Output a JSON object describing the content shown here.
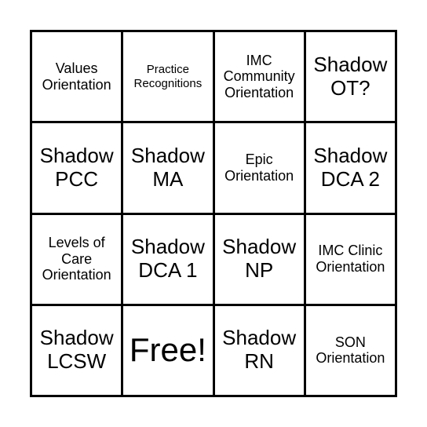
{
  "board": {
    "cells": [
      {
        "text": "Values\nOrientation",
        "size": "md"
      },
      {
        "text": "Practice\nRecognitions",
        "size": "sm"
      },
      {
        "text": "IMC\nCommunity\nOrientation",
        "size": "md"
      },
      {
        "text": "Shadow\nOT?",
        "size": "lg"
      },
      {
        "text": "Shadow\nPCC",
        "size": "lg"
      },
      {
        "text": "Shadow\nMA",
        "size": "lg"
      },
      {
        "text": "Epic\nOrientation",
        "size": "md"
      },
      {
        "text": "Shadow\nDCA 2",
        "size": "lg"
      },
      {
        "text": "Levels of\nCare\nOrientation",
        "size": "md"
      },
      {
        "text": "Shadow\nDCA 1",
        "size": "lg"
      },
      {
        "text": "Shadow\nNP",
        "size": "lg"
      },
      {
        "text": "IMC Clinic\nOrientation",
        "size": "md"
      },
      {
        "text": "Shadow\nLCSW",
        "size": "lg"
      },
      {
        "text": "Free!",
        "size": "xl"
      },
      {
        "text": "Shadow\nRN",
        "size": "lg"
      },
      {
        "text": "SON\nOrientation",
        "size": "md"
      }
    ]
  }
}
